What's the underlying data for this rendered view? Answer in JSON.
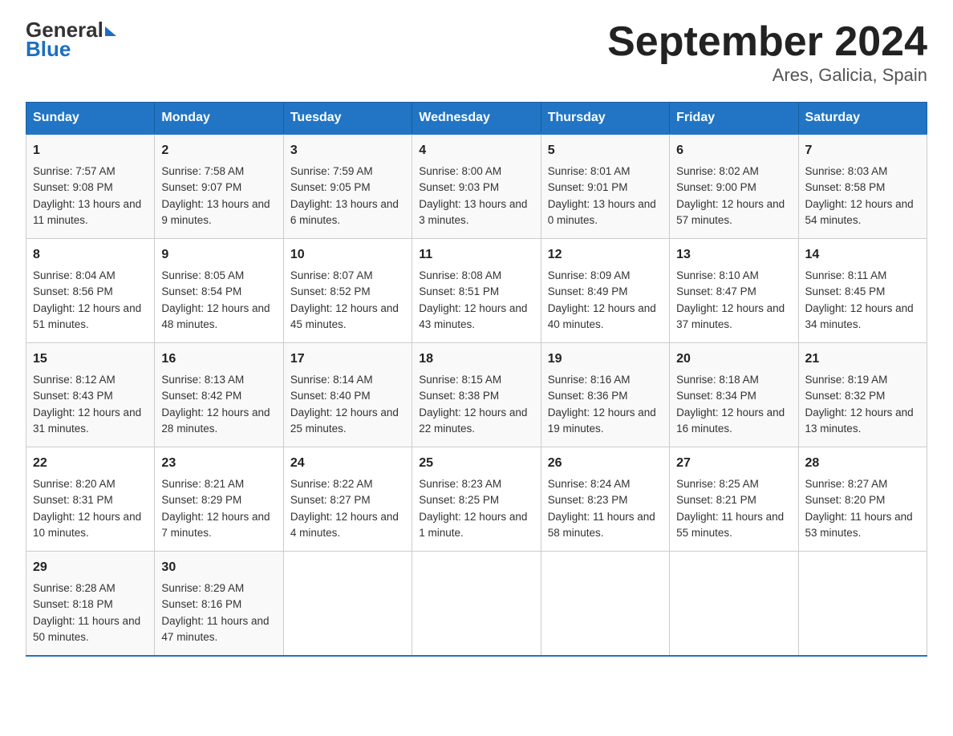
{
  "header": {
    "logo_line1": "General",
    "logo_line2": "Blue",
    "title": "September 2024",
    "subtitle": "Ares, Galicia, Spain"
  },
  "days_of_week": [
    "Sunday",
    "Monday",
    "Tuesday",
    "Wednesday",
    "Thursday",
    "Friday",
    "Saturday"
  ],
  "weeks": [
    [
      {
        "day": "1",
        "sunrise": "7:57 AM",
        "sunset": "9:08 PM",
        "daylight": "13 hours and 11 minutes."
      },
      {
        "day": "2",
        "sunrise": "7:58 AM",
        "sunset": "9:07 PM",
        "daylight": "13 hours and 9 minutes."
      },
      {
        "day": "3",
        "sunrise": "7:59 AM",
        "sunset": "9:05 PM",
        "daylight": "13 hours and 6 minutes."
      },
      {
        "day": "4",
        "sunrise": "8:00 AM",
        "sunset": "9:03 PM",
        "daylight": "13 hours and 3 minutes."
      },
      {
        "day": "5",
        "sunrise": "8:01 AM",
        "sunset": "9:01 PM",
        "daylight": "13 hours and 0 minutes."
      },
      {
        "day": "6",
        "sunrise": "8:02 AM",
        "sunset": "9:00 PM",
        "daylight": "12 hours and 57 minutes."
      },
      {
        "day": "7",
        "sunrise": "8:03 AM",
        "sunset": "8:58 PM",
        "daylight": "12 hours and 54 minutes."
      }
    ],
    [
      {
        "day": "8",
        "sunrise": "8:04 AM",
        "sunset": "8:56 PM",
        "daylight": "12 hours and 51 minutes."
      },
      {
        "day": "9",
        "sunrise": "8:05 AM",
        "sunset": "8:54 PM",
        "daylight": "12 hours and 48 minutes."
      },
      {
        "day": "10",
        "sunrise": "8:07 AM",
        "sunset": "8:52 PM",
        "daylight": "12 hours and 45 minutes."
      },
      {
        "day": "11",
        "sunrise": "8:08 AM",
        "sunset": "8:51 PM",
        "daylight": "12 hours and 43 minutes."
      },
      {
        "day": "12",
        "sunrise": "8:09 AM",
        "sunset": "8:49 PM",
        "daylight": "12 hours and 40 minutes."
      },
      {
        "day": "13",
        "sunrise": "8:10 AM",
        "sunset": "8:47 PM",
        "daylight": "12 hours and 37 minutes."
      },
      {
        "day": "14",
        "sunrise": "8:11 AM",
        "sunset": "8:45 PM",
        "daylight": "12 hours and 34 minutes."
      }
    ],
    [
      {
        "day": "15",
        "sunrise": "8:12 AM",
        "sunset": "8:43 PM",
        "daylight": "12 hours and 31 minutes."
      },
      {
        "day": "16",
        "sunrise": "8:13 AM",
        "sunset": "8:42 PM",
        "daylight": "12 hours and 28 minutes."
      },
      {
        "day": "17",
        "sunrise": "8:14 AM",
        "sunset": "8:40 PM",
        "daylight": "12 hours and 25 minutes."
      },
      {
        "day": "18",
        "sunrise": "8:15 AM",
        "sunset": "8:38 PM",
        "daylight": "12 hours and 22 minutes."
      },
      {
        "day": "19",
        "sunrise": "8:16 AM",
        "sunset": "8:36 PM",
        "daylight": "12 hours and 19 minutes."
      },
      {
        "day": "20",
        "sunrise": "8:18 AM",
        "sunset": "8:34 PM",
        "daylight": "12 hours and 16 minutes."
      },
      {
        "day": "21",
        "sunrise": "8:19 AM",
        "sunset": "8:32 PM",
        "daylight": "12 hours and 13 minutes."
      }
    ],
    [
      {
        "day": "22",
        "sunrise": "8:20 AM",
        "sunset": "8:31 PM",
        "daylight": "12 hours and 10 minutes."
      },
      {
        "day": "23",
        "sunrise": "8:21 AM",
        "sunset": "8:29 PM",
        "daylight": "12 hours and 7 minutes."
      },
      {
        "day": "24",
        "sunrise": "8:22 AM",
        "sunset": "8:27 PM",
        "daylight": "12 hours and 4 minutes."
      },
      {
        "day": "25",
        "sunrise": "8:23 AM",
        "sunset": "8:25 PM",
        "daylight": "12 hours and 1 minute."
      },
      {
        "day": "26",
        "sunrise": "8:24 AM",
        "sunset": "8:23 PM",
        "daylight": "11 hours and 58 minutes."
      },
      {
        "day": "27",
        "sunrise": "8:25 AM",
        "sunset": "8:21 PM",
        "daylight": "11 hours and 55 minutes."
      },
      {
        "day": "28",
        "sunrise": "8:27 AM",
        "sunset": "8:20 PM",
        "daylight": "11 hours and 53 minutes."
      }
    ],
    [
      {
        "day": "29",
        "sunrise": "8:28 AM",
        "sunset": "8:18 PM",
        "daylight": "11 hours and 50 minutes."
      },
      {
        "day": "30",
        "sunrise": "8:29 AM",
        "sunset": "8:16 PM",
        "daylight": "11 hours and 47 minutes."
      },
      null,
      null,
      null,
      null,
      null
    ]
  ]
}
